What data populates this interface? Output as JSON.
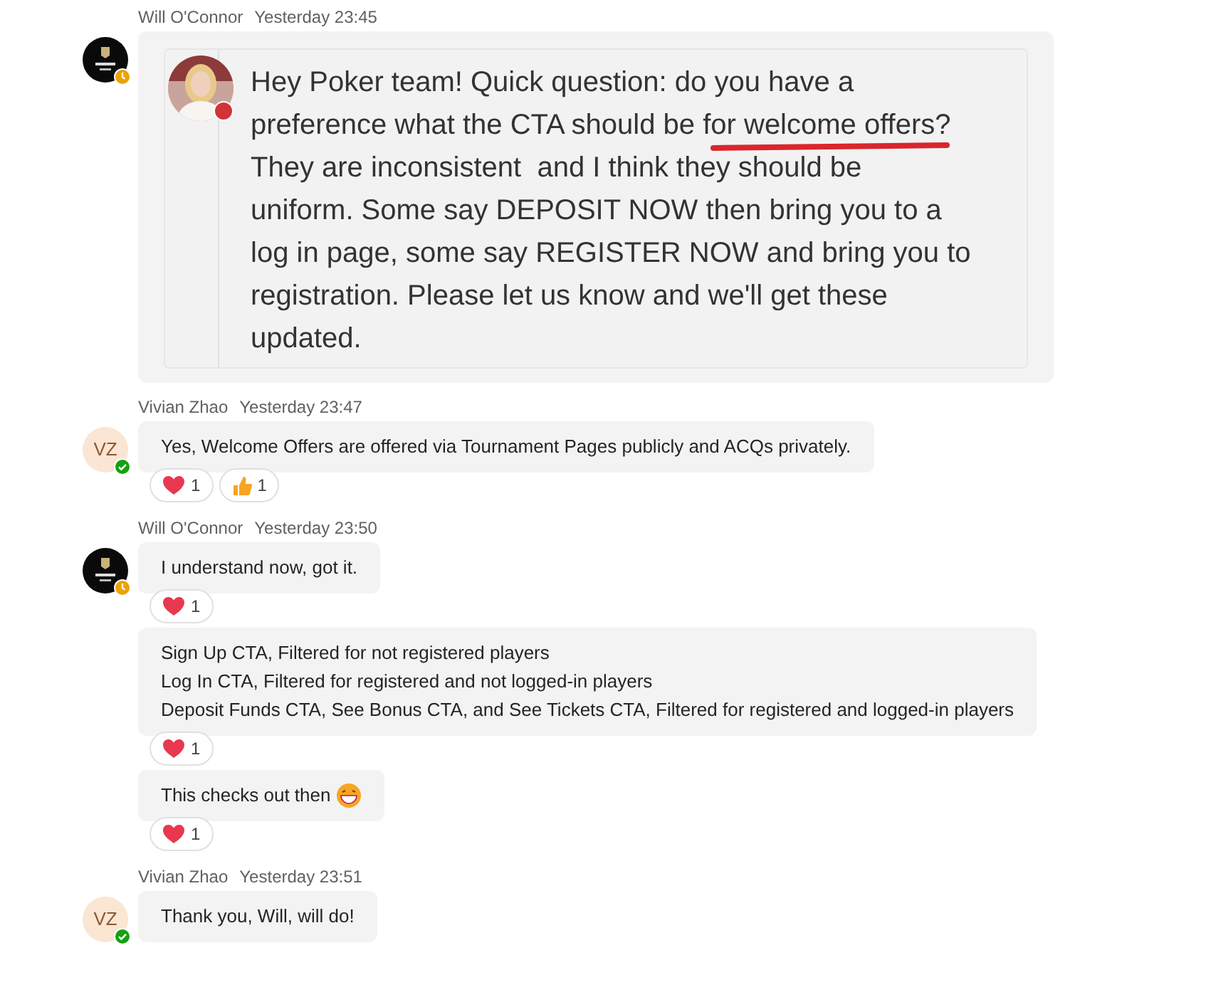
{
  "groups": [
    {
      "author": "Will O'Connor",
      "time": "Yesterday 23:45",
      "avatar": {
        "kind": "logo"
      },
      "badge": {
        "kind": "away"
      },
      "messages": [
        {
          "kind": "screenshot",
          "lines": [
            {
              "text": "Hey Poker team! Quick question: do you have a",
              "underlined": false
            },
            {
              "text": "preference what the CTA should be for welcome offers?",
              "underlined": true
            },
            {
              "text": "They are inconsistent  and I think they should be",
              "underlined": false
            },
            {
              "text": "uniform. Some say DEPOSIT NOW then bring you to a",
              "underlined": false
            },
            {
              "text": "log in page, some say REGISTER NOW and bring you to",
              "underlined": false
            },
            {
              "text": "registration. Please let us know and we'll get these",
              "underlined": false
            },
            {
              "text": "updated.",
              "underlined": false
            }
          ],
          "sender_badge": {
            "kind": "busy"
          }
        }
      ]
    },
    {
      "author": "Vivian Zhao",
      "time": "Yesterday 23:47",
      "avatar": {
        "kind": "initials",
        "initials": "VZ"
      },
      "badge": {
        "kind": "available"
      },
      "messages": [
        {
          "kind": "text",
          "text": "Yes, Welcome Offers are offered via Tournament Pages publicly and ACQs privately.",
          "reactions": [
            {
              "kind": "heart",
              "count": "1"
            },
            {
              "kind": "thumbs",
              "count": "1"
            }
          ]
        }
      ]
    },
    {
      "author": "Will O'Connor",
      "time": "Yesterday 23:50",
      "avatar": {
        "kind": "logo"
      },
      "badge": {
        "kind": "away"
      },
      "messages": [
        {
          "kind": "text",
          "text": "I understand now, got it.",
          "reactions": [
            {
              "kind": "heart",
              "count": "1"
            }
          ]
        },
        {
          "kind": "lines",
          "lines": [
            "Sign Up CTA, Filtered for not registered players",
            "Log In CTA, Filtered for registered and not logged-in players",
            "Deposit Funds CTA, See Bonus CTA, and See Tickets CTA, Filtered for registered and logged-in players"
          ],
          "reactions": [
            {
              "kind": "heart",
              "count": "1"
            }
          ]
        },
        {
          "kind": "text",
          "text": "This checks out then",
          "emoji": {
            "kind": "grin"
          },
          "reactions": [
            {
              "kind": "heart",
              "count": "1"
            }
          ]
        }
      ]
    },
    {
      "author": "Vivian Zhao",
      "time": "Yesterday 23:51",
      "avatar": {
        "kind": "initials",
        "initials": "VZ"
      },
      "badge": {
        "kind": "available"
      },
      "messages": [
        {
          "kind": "text",
          "text": "Thank you, Will, will do!"
        }
      ]
    }
  ]
}
